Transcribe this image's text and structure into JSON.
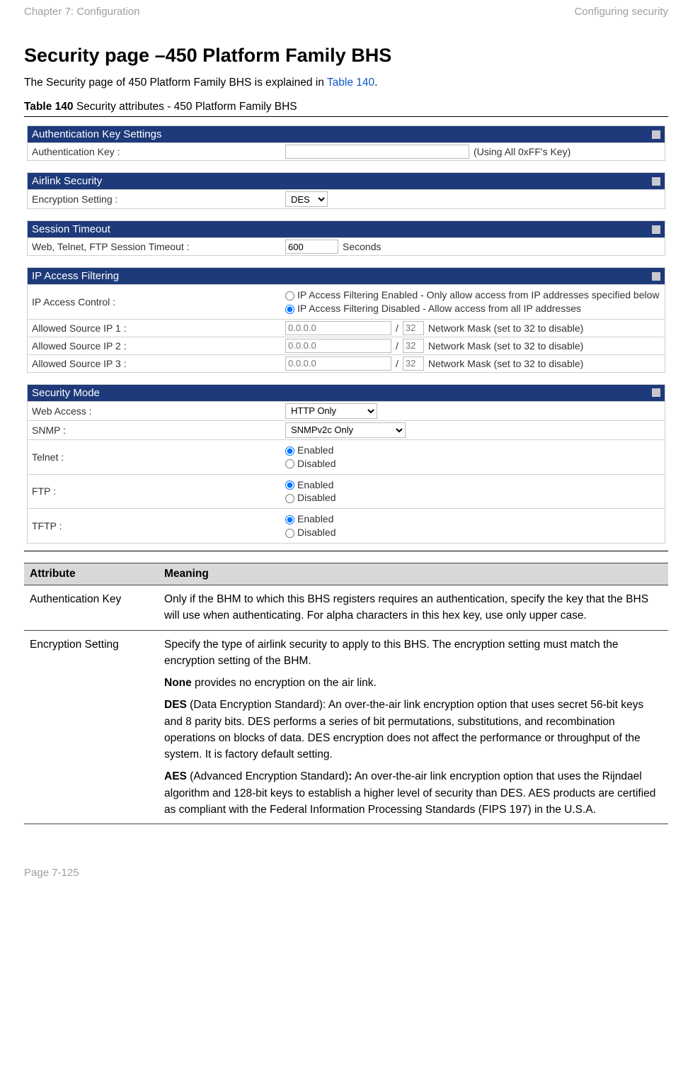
{
  "header": {
    "left": "Chapter 7:  Configuration",
    "right": "Configuring security"
  },
  "title": "Security page –450 Platform Family BHS",
  "intro_before": "The Security page of 450 Platform Family BHS is explained in ",
  "intro_link": "Table 140",
  "intro_after": ".",
  "table_caption_bold": "Table 140",
  "table_caption_rest": " Security attributes - 450 Platform Family BHS",
  "panels": {
    "auth": {
      "title": "Authentication Key Settings",
      "label": "Authentication Key :",
      "hint": "(Using All 0xFF's Key)"
    },
    "airlink": {
      "title": "Airlink Security",
      "label": "Encryption Setting :",
      "select": "DES"
    },
    "session": {
      "title": "Session Timeout",
      "label": "Web, Telnet, FTP Session Timeout :",
      "value": "600",
      "unit": "Seconds"
    },
    "ipfilter": {
      "title": "IP Access Filtering",
      "control_label": "IP Access Control :",
      "opt_enabled": "IP Access Filtering Enabled - Only allow access from IP addresses specified below",
      "opt_disabled": "IP Access Filtering Disabled - Allow access from all IP addresses",
      "rows": [
        {
          "label": "Allowed Source IP 1 :",
          "ip": "0.0.0.0",
          "mask": "32",
          "note": "Network Mask (set to 32 to disable)"
        },
        {
          "label": "Allowed Source IP 2 :",
          "ip": "0.0.0.0",
          "mask": "32",
          "note": "Network Mask (set to 32 to disable)"
        },
        {
          "label": "Allowed Source IP 3 :",
          "ip": "0.0.0.0",
          "mask": "32",
          "note": "Network Mask (set to 32 to disable)"
        }
      ]
    },
    "secmode": {
      "title": "Security Mode",
      "web_label": "Web Access :",
      "web_value": "HTTP Only",
      "snmp_label": "SNMP :",
      "snmp_value": "SNMPv2c Only",
      "telnet_label": "Telnet :",
      "ftp_label": "FTP :",
      "tftp_label": "TFTP :",
      "enabled": "Enabled",
      "disabled": "Disabled"
    }
  },
  "attr_table": {
    "headers": [
      "Attribute",
      "Meaning"
    ],
    "rows": [
      {
        "attr": "Authentication Key",
        "meaning": [
          "Only if the BHM to which this BHS registers requires an authentication, specify the key that the BHS will use when authenticating. For alpha characters in this hex key, use only upper case."
        ]
      },
      {
        "attr": "Encryption Setting",
        "meaning": [
          "Specify the type of airlink security to apply to this BHS. The encryption setting must match the encryption setting of the BHM.",
          "<b>None</b> provides no encryption on the air link.",
          "<b>DES</b> (Data Encryption Standard): An over-the-air link encryption option that uses secret 56-bit keys and 8 parity bits. DES performs a series of bit permutations, substitutions, and recombination operations on blocks of data. DES encryption does not affect the performance or throughput of the system. It is factory default setting.",
          "<b>AES</b> (Advanced Encryption Standard)<b>:</b> An over-the-air link encryption option that uses the Rijndael algorithm and 128-bit keys to establish a higher level of security than DES. AES products are certified as compliant with the Federal Information Processing Standards (FIPS 197) in the U.S.A."
        ]
      }
    ]
  },
  "footer": "Page 7-125"
}
